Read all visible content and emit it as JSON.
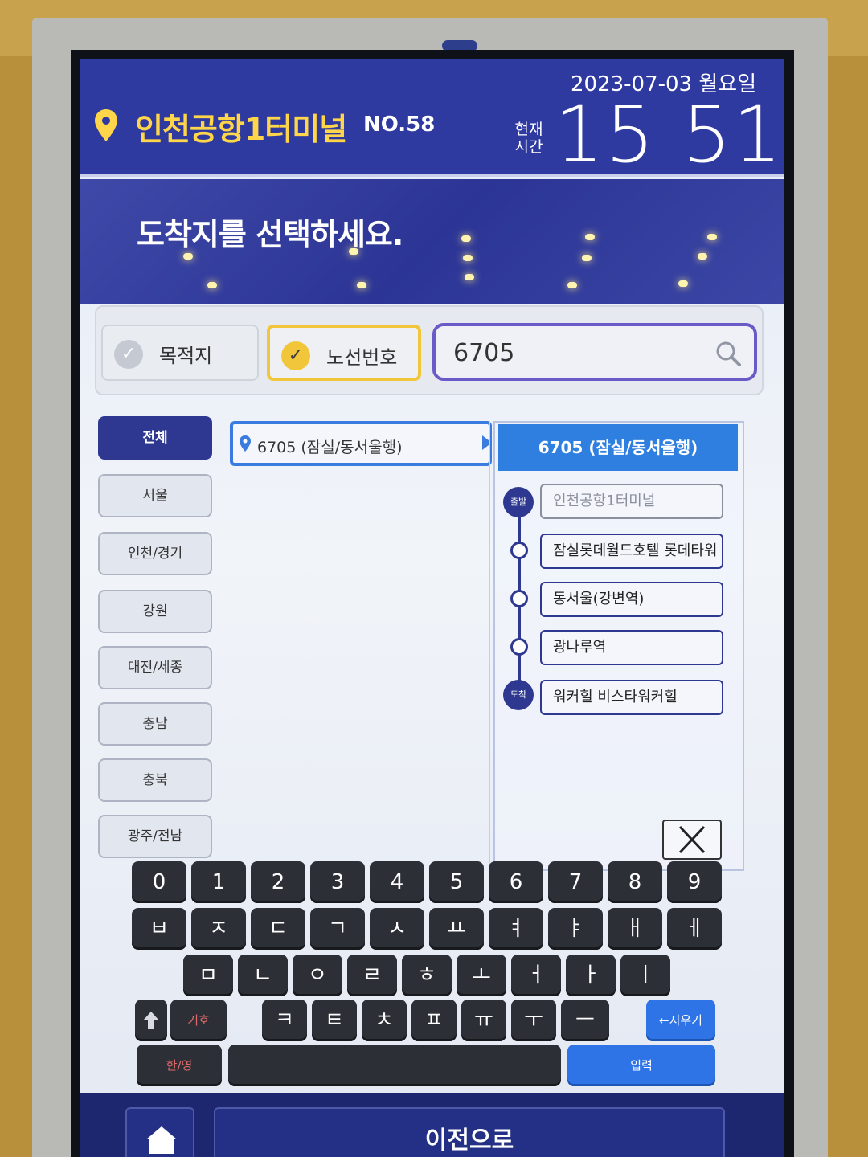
{
  "header": {
    "location": "인천공항1터미널",
    "terminal_no": "NO.58",
    "date": "2023-07-03 월요일",
    "now_label_1": "현재",
    "now_label_2": "시간",
    "time": "15 51"
  },
  "banner": {
    "title": "도착지를 선택하세요."
  },
  "search": {
    "tab_destination": "목적지",
    "tab_route_number": "노선번호",
    "query": "6705",
    "selected_tab": "노선번호"
  },
  "regions": [
    "전체",
    "서울",
    "인천/경기",
    "강원",
    "대전/세종",
    "충남",
    "충북",
    "광주/전남"
  ],
  "routes": [
    {
      "label": "6705 (잠실/동서울행)"
    }
  ],
  "route_detail": {
    "title": "6705 (잠실/동서울행)",
    "origin_badge": "출발",
    "destination_badge": "도착",
    "stops": [
      "인천공항1터미널",
      "잠실롯데월드호텔 롯데타워",
      "동서울(강변역)",
      "광나루역",
      "워커힐 비스타워커힐"
    ]
  },
  "keyboard": {
    "row1": [
      "0",
      "1",
      "2",
      "3",
      "4",
      "5",
      "6",
      "7",
      "8",
      "9"
    ],
    "row2": [
      "ㅂ",
      "ㅈ",
      "ㄷ",
      "ㄱ",
      "ㅅ",
      "ㅛ",
      "ㅕ",
      "ㅑ",
      "ㅐ",
      "ㅔ"
    ],
    "row3": [
      "ㅁ",
      "ㄴ",
      "ㅇ",
      "ㄹ",
      "ㅎ",
      "ㅗ",
      "ㅓ",
      "ㅏ",
      "ㅣ"
    ],
    "row4": [
      "ㅋ",
      "ㅌ",
      "ㅊ",
      "ㅍ",
      "ㅠ",
      "ㅜ",
      "ㅡ"
    ],
    "symbols": "기호",
    "backspace": "←지우기",
    "lang_toggle": "한/영",
    "enter": "입력"
  },
  "footer": {
    "back": "이전으로"
  },
  "colors": {
    "header_bg": "#2f3aa0",
    "accent_yellow": "#ffd54a",
    "route_blue": "#2f7fe0",
    "key_dark": "#2c2f36"
  }
}
